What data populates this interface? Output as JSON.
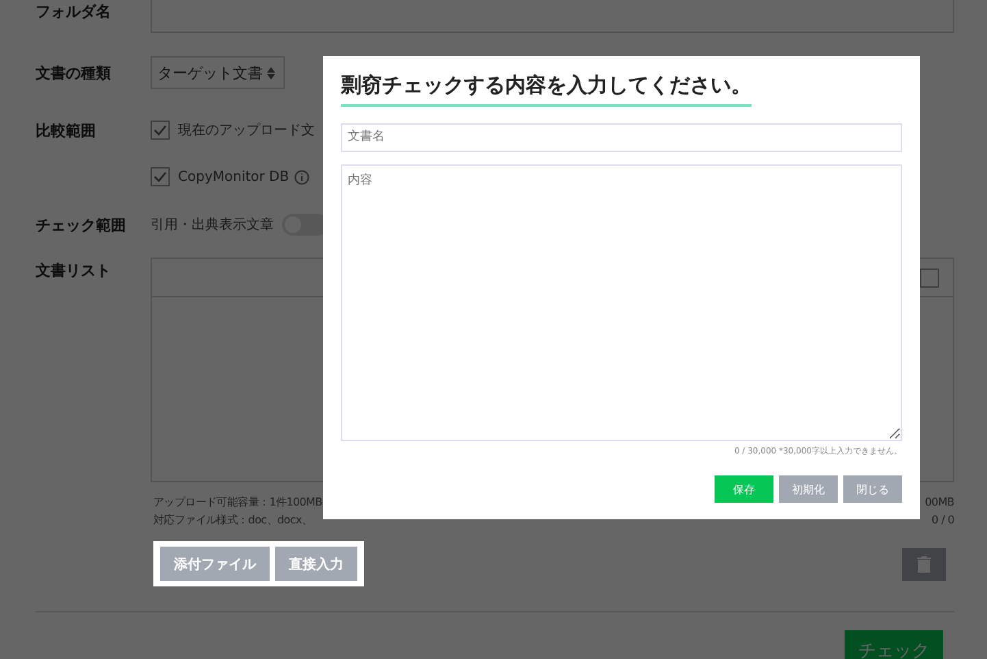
{
  "form": {
    "folder_name": {
      "label": "フォルダ名"
    },
    "document_type": {
      "label": "文書の種類",
      "value": "ターゲット文書"
    },
    "comparison_scope": {
      "label": "比較範囲",
      "options": [
        {
          "label": "現在のアップロード文",
          "checked": true
        },
        {
          "label": "CopyMonitor DB",
          "checked": true
        }
      ]
    },
    "check_scope": {
      "label": "チェック範囲",
      "toggle_label": "引用・出典表示文章",
      "on": false
    },
    "document_list": {
      "label": "文書リスト",
      "header_checked": false,
      "upload_info": [
        "アップロード可能容量：1件100MB",
        "対応ファイル様式：doc、docx、"
      ],
      "right_info": [
        "00MB",
        "0 / 0"
      ]
    },
    "buttons": [
      "添付ファイル",
      "直接入力"
    ],
    "check_button": "チェック"
  },
  "modal": {
    "title": "剽窃チェックする内容を入力してください。",
    "name_placeholder": "文書名",
    "content_placeholder": "内容",
    "counter": "0 / 30,000 *30,000字以上入力できません。",
    "buttons": [
      {
        "label": "保存",
        "kind": "primary"
      },
      {
        "label": "初期化",
        "kind": "secondary"
      },
      {
        "label": "閉じる",
        "kind": "secondary"
      }
    ]
  }
}
